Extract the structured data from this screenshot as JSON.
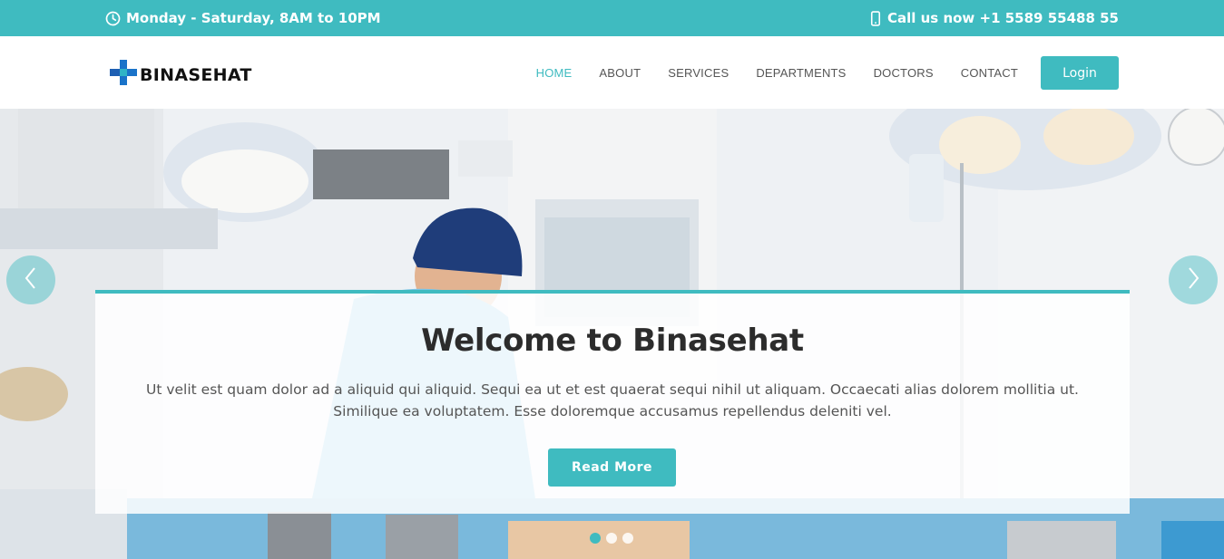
{
  "topbar": {
    "hours": "Monday - Saturday, 8AM to 10PM",
    "phone": "Call us now +1 5589 55488 55",
    "icons": {
      "hours": "clock-icon",
      "phone": "mobile-phone-icon"
    }
  },
  "brand": {
    "name": "BINASEHAT",
    "logo_icon": "medical-cross-icon"
  },
  "nav": {
    "items": [
      {
        "label": "HOME",
        "active": true
      },
      {
        "label": "ABOUT"
      },
      {
        "label": "SERVICES"
      },
      {
        "label": "DEPARTMENTS"
      },
      {
        "label": "DOCTORS"
      },
      {
        "label": "CONTACT"
      }
    ],
    "login": "Login"
  },
  "hero": {
    "title": "Welcome to Binasehat",
    "text": "Ut velit est quam dolor ad a aliquid qui aliquid. Sequi ea ut et est quaerat sequi nihil ut aliquam. Occaecati alias dolorem mollitia ut. Similique ea voluptatem. Esse doloremque accusamus repellendus deleniti vel.",
    "cta": "Read More",
    "prev_icon": "chevron-left-icon",
    "next_icon": "chevron-right-icon",
    "slides_count": 3,
    "active_slide": 1
  },
  "colors": {
    "accent": "#3fbbc0",
    "text_dark": "#2c2c2c",
    "text_muted": "#555555"
  }
}
